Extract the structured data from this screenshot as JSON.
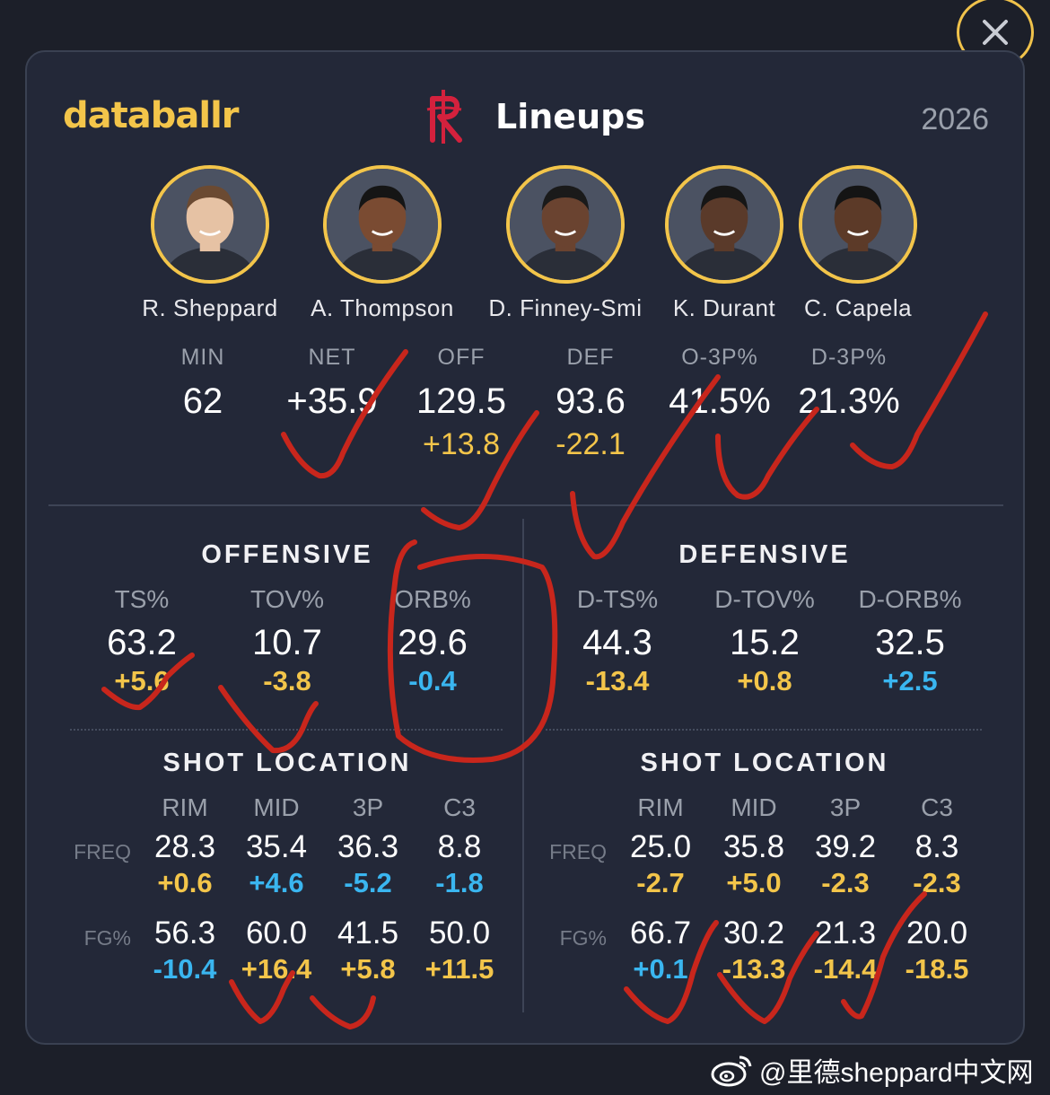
{
  "header": {
    "brand": "databallr",
    "title": "Lineups",
    "year": "2026",
    "team_logo": "rockets-logo-icon"
  },
  "close_button": {
    "icon": "close-icon"
  },
  "players": [
    {
      "name": "R. Sheppard"
    },
    {
      "name": "A. Thompson"
    },
    {
      "name": "D. Finney-Smi"
    },
    {
      "name": "K. Durant"
    },
    {
      "name": "C. Capela"
    }
  ],
  "summary": [
    {
      "label": "MIN",
      "value": "62",
      "delta": ""
    },
    {
      "label": "NET",
      "value": "+35.9",
      "delta": ""
    },
    {
      "label": "OFF",
      "value": "129.5",
      "delta": "+13.8"
    },
    {
      "label": "DEF",
      "value": "93.6",
      "delta": "-22.1"
    },
    {
      "label": "O-3P%",
      "value": "41.5%",
      "delta": ""
    },
    {
      "label": "D-3P%",
      "value": "21.3%",
      "delta": ""
    }
  ],
  "offensive": {
    "title": "OFFENSIVE",
    "stats": [
      {
        "label": "TS%",
        "value": "63.2",
        "delta": "+5.6"
      },
      {
        "label": "TOV%",
        "value": "10.7",
        "delta": "-3.8"
      },
      {
        "label": "ORB%",
        "value": "29.6",
        "delta": "-0.4"
      }
    ],
    "shot_title": "SHOT LOCATION",
    "columns": [
      "RIM",
      "MID",
      "3P",
      "C3"
    ],
    "freq_label": "FREQ",
    "fg_label": "FG%",
    "freq": [
      {
        "value": "28.3",
        "delta": "+0.6"
      },
      {
        "value": "35.4",
        "delta": "+4.6"
      },
      {
        "value": "36.3",
        "delta": "-5.2"
      },
      {
        "value": "8.8",
        "delta": "-1.8"
      }
    ],
    "fg": [
      {
        "value": "56.3",
        "delta": "-10.4"
      },
      {
        "value": "60.0",
        "delta": "+16.4"
      },
      {
        "value": "41.5",
        "delta": "+5.8"
      },
      {
        "value": "50.0",
        "delta": "+11.5"
      }
    ]
  },
  "defensive": {
    "title": "DEFENSIVE",
    "stats": [
      {
        "label": "D-TS%",
        "value": "44.3",
        "delta": "-13.4"
      },
      {
        "label": "D-TOV%",
        "value": "15.2",
        "delta": "+0.8"
      },
      {
        "label": "D-ORB%",
        "value": "32.5",
        "delta": "+2.5"
      }
    ],
    "shot_title": "SHOT LOCATION",
    "columns": [
      "RIM",
      "MID",
      "3P",
      "C3"
    ],
    "freq_label": "FREQ",
    "fg_label": "FG%",
    "freq": [
      {
        "value": "25.0",
        "delta": "-2.7"
      },
      {
        "value": "35.8",
        "delta": "+5.0"
      },
      {
        "value": "39.2",
        "delta": "-2.3"
      },
      {
        "value": "8.3",
        "delta": "-2.3"
      }
    ],
    "fg": [
      {
        "value": "66.7",
        "delta": "+0.1"
      },
      {
        "value": "30.2",
        "delta": "-13.3"
      },
      {
        "value": "21.3",
        "delta": "-14.4"
      },
      {
        "value": "20.0",
        "delta": "-18.5"
      }
    ]
  },
  "colors": {
    "gold": "#f3c54a",
    "blue": "#3ab6f0",
    "annotation_red": "#c8261c",
    "card": "#232838"
  },
  "watermark": {
    "text": "@里德sheppard中文网",
    "icon": "weibo-icon"
  }
}
